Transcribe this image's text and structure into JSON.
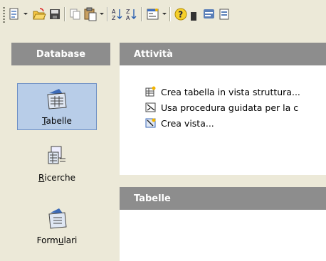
{
  "toolbar": {
    "buttons": [
      {
        "icon": "new-document-icon",
        "has_dropdown": true
      },
      {
        "icon": "open-folder-icon",
        "has_dropdown": false
      },
      {
        "icon": "save-icon",
        "has_dropdown": false
      },
      {
        "icon": "copy-icon",
        "has_dropdown": false
      },
      {
        "icon": "paste-icon",
        "has_dropdown": true
      },
      {
        "icon": "sort-ascending-icon",
        "has_dropdown": false
      },
      {
        "icon": "sort-descending-icon",
        "has_dropdown": false
      },
      {
        "icon": "form-icon",
        "has_dropdown": true
      },
      {
        "icon": "help-icon",
        "has_dropdown": false
      },
      {
        "icon": "form-view-icon",
        "has_dropdown": false
      },
      {
        "icon": "report-icon",
        "has_dropdown": false
      }
    ]
  },
  "nav": {
    "title": "Database",
    "items": [
      {
        "label": "Tabelle",
        "icon": "table-icon",
        "selected": true
      },
      {
        "label": "Ricerche",
        "icon": "query-icon",
        "selected": false
      },
      {
        "label": "Formulari",
        "icon": "form-icon",
        "selected": false
      }
    ]
  },
  "tasks": {
    "title": "Attività",
    "items": [
      {
        "label": "Crea tabella in vista struttura...",
        "icon": "create-table-icon"
      },
      {
        "label": "Usa procedura guidata per la c",
        "icon": "wizard-icon"
      },
      {
        "label": "Crea vista...",
        "icon": "create-view-icon"
      }
    ]
  },
  "content": {
    "title": "Tabelle"
  },
  "colors": {
    "background": "#ece9d8",
    "header": "#8d8d8d",
    "selection": "#b8cde8",
    "selection_border": "#6d8fc5"
  }
}
